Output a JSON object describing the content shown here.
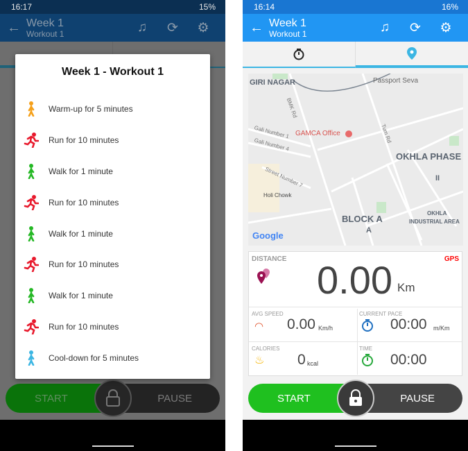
{
  "left": {
    "status": {
      "time": "16:17",
      "battery": "15%"
    },
    "appbar": {
      "title": "Week 1",
      "subtitle": "Workout 1"
    },
    "dialog": {
      "title": "Week 1 - Workout 1",
      "steps": [
        {
          "type": "warmup",
          "label": "Warm-up for 5 minutes",
          "color": "#f5a01a"
        },
        {
          "type": "run",
          "label": "Run for 10 minutes",
          "color": "#e8192c"
        },
        {
          "type": "walk",
          "label": "Walk for 1 minute",
          "color": "#25b825"
        },
        {
          "type": "run",
          "label": "Run for 10 minutes",
          "color": "#e8192c"
        },
        {
          "type": "walk",
          "label": "Walk for 1 minute",
          "color": "#25b825"
        },
        {
          "type": "run",
          "label": "Run for 10 minutes",
          "color": "#e8192c"
        },
        {
          "type": "walk",
          "label": "Walk for 1 minute",
          "color": "#25b825"
        },
        {
          "type": "run",
          "label": "Run for 10 minutes",
          "color": "#e8192c"
        },
        {
          "type": "cooldown",
          "label": "Cool-down for 5 minutes",
          "color": "#3cb6e3"
        }
      ]
    },
    "controls": {
      "start": "START",
      "pause": "PAUSE"
    }
  },
  "right": {
    "status": {
      "time": "16:14",
      "battery": "16%"
    },
    "appbar": {
      "title": "Week 1",
      "subtitle": "Workout 1"
    },
    "map": {
      "labels": [
        "GIRI NAGAR",
        "Passport Seva",
        "BMK Rd",
        "Gali Number 1",
        "Gali Number 4",
        "GAMCA Office",
        "Tum Rd",
        "OKHLA PHASE",
        "II",
        "Street Number 7",
        "Holi Chowk",
        "BLOCK A",
        "A",
        "OKHLA",
        "INDUSTRIAL AREA"
      ],
      "logo": "Google"
    },
    "stats": {
      "distance": {
        "label": "DISTANCE",
        "value": "0.00",
        "unit": "Km",
        "gps": "GPS"
      },
      "avg_speed": {
        "label": "AVG SPEED",
        "value": "0.00",
        "unit": "Km/h"
      },
      "current_pace": {
        "label": "CURRENT PACE",
        "value": "00:00",
        "unit": "m/Km"
      },
      "calories": {
        "label": "CALORIES",
        "value": "0",
        "unit": "kcal"
      },
      "time": {
        "label": "TIME",
        "value": "00:00"
      }
    },
    "controls": {
      "start": "START",
      "pause": "PAUSE"
    }
  },
  "colors": {
    "appbar": "#2196f3",
    "statusbar": "#1976d2",
    "accent": "#3cb6e3",
    "start": "#1fc01f",
    "gps": "#ff0000"
  }
}
